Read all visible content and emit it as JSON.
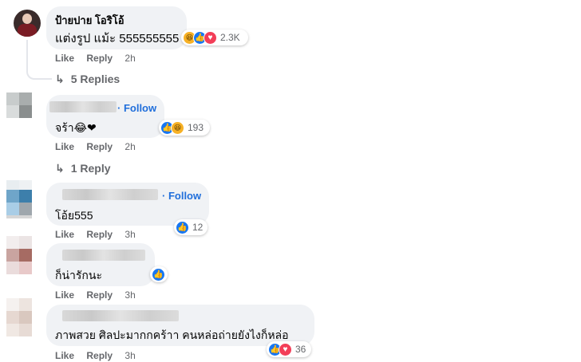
{
  "comments": [
    {
      "author": "ป้ายปาย โอริโอ้",
      "text": "แต่งรูป แม้ะ 555555555",
      "reaction_count": "2.3K",
      "reactions": [
        "haha-icon",
        "like-icon",
        "love-icon"
      ],
      "actions": {
        "like": "Like",
        "reply": "Reply",
        "time": "2h"
      },
      "replies": "5 Replies"
    },
    {
      "follow": "Follow",
      "text": "จร้า😂❤",
      "reaction_count": "193",
      "reactions": [
        "like-icon",
        "haha-icon"
      ],
      "actions": {
        "like": "Like",
        "reply": "Reply",
        "time": "2h"
      },
      "replies": "1 Reply"
    },
    {
      "follow": "Follow",
      "text": "โอ้ย555",
      "reaction_count": "12",
      "reactions": [
        "like-icon"
      ],
      "actions": {
        "like": "Like",
        "reply": "Reply",
        "time": "3h"
      }
    },
    {
      "text": "ก็น่ารักนะ",
      "reactions": [
        "like-icon"
      ],
      "actions": {
        "like": "Like",
        "reply": "Reply",
        "time": "3h"
      }
    },
    {
      "text": "ภาพสวย ศิลปะมากกคร้าา คนหล่อถ่ายยังไงก็หล่อ",
      "reaction_count": "36",
      "reactions": [
        "like-icon",
        "love-icon"
      ],
      "actions": {
        "like": "Like",
        "reply": "Reply",
        "time": "3h"
      }
    }
  ],
  "colors": {
    "bubble": "#f0f2f5",
    "link": "#216fdb",
    "meta": "#65676b",
    "like": "#1877f2",
    "love": "#f33e58",
    "haha": "#f7b125"
  }
}
